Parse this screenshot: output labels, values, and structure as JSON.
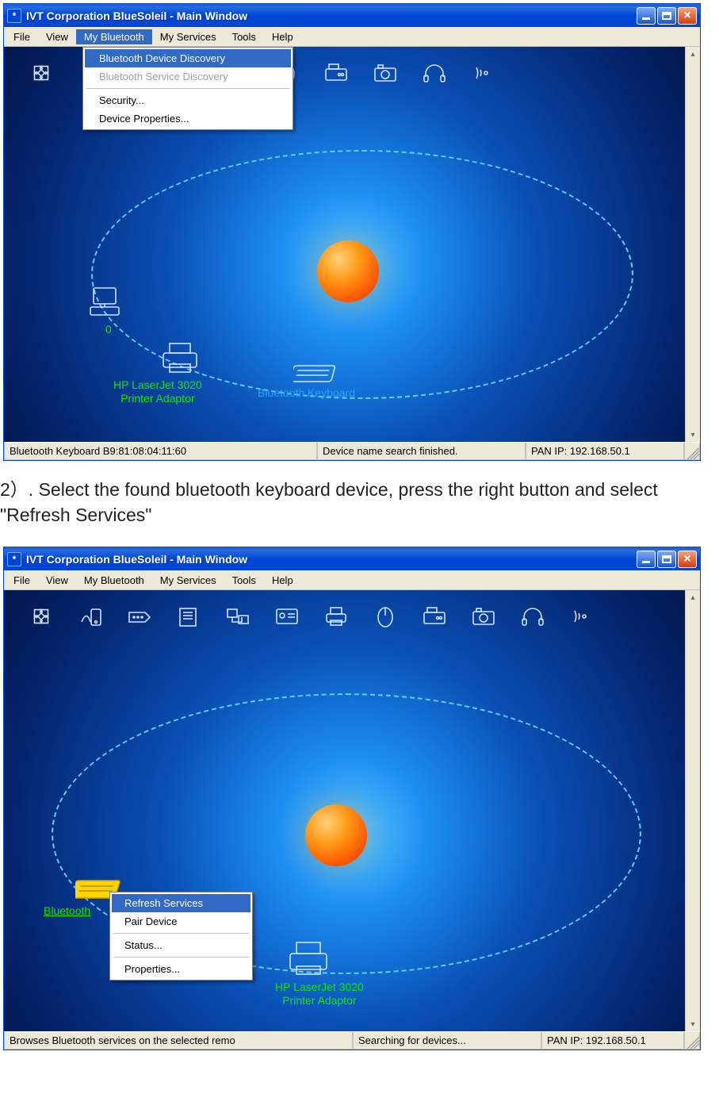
{
  "instruction_text": "2）. Select the found bluetooth keyboard device, press the right button and select \"Refresh Services\"",
  "window_title": "IVT Corporation BlueSoleil - Main Window",
  "menubar": {
    "file": "File",
    "view": "View",
    "my_bluetooth": "My Bluetooth",
    "my_services": "My Services",
    "tools": "Tools",
    "help": "Help"
  },
  "mybt_menu": {
    "discovery": "Bluetooth Device Discovery",
    "service_discovery": "Bluetooth Service Discovery",
    "security": "Security...",
    "device_properties": "Device Properties..."
  },
  "context_menu": {
    "refresh": "Refresh Services",
    "pair": "Pair Device",
    "status": "Status...",
    "properties": "Properties..."
  },
  "devices1": {
    "computer_label": "0",
    "printer_line1": "HP LaserJet 3020",
    "printer_line2": "Printer Adaptor",
    "keyboard": "Bluetooth Keyboard"
  },
  "devices2": {
    "keyboard": "Bluetooth",
    "printer_line1": "HP LaserJet 3020",
    "printer_line2": "Printer Adaptor"
  },
  "status1": {
    "left": "Bluetooth Keyboard  B9:81:08:04:11:60",
    "center": "Device name search finished.",
    "right": "PAN IP: 192.168.50.1"
  },
  "status2": {
    "left": "Browses Bluetooth services on the selected remo",
    "center": "Searching for devices...",
    "right": "PAN IP: 192.168.50.1"
  }
}
